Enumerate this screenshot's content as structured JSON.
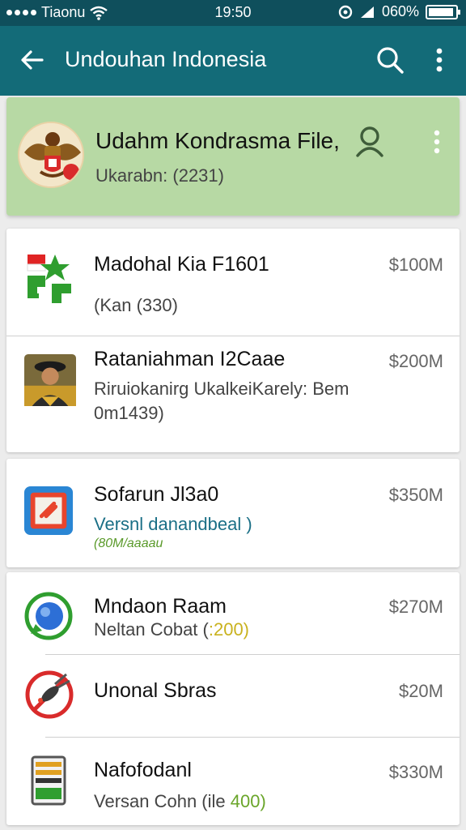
{
  "status_bar": {
    "carrier": "Tiaonu",
    "time": "19:50",
    "battery": "060%"
  },
  "toolbar": {
    "title": "Undouhan Indonesia",
    "icons": [
      "back-arrow-icon",
      "search-icon",
      "more-vert-icon"
    ]
  },
  "header": {
    "title": "Udahm Kondrasma File,",
    "subtitle": "Ukarabn: (2231)",
    "accent_color": "#b7d9a4"
  },
  "items": [
    {
      "title": "Madohal Kia F1601",
      "subtitle": "(Kan (330)",
      "price": "$100M"
    },
    {
      "title": "Rataniahman I2Caae",
      "subtitle": "Riruiokanirg UkalkeiKarely: Bem",
      "subtitle2": "0m1439)",
      "price": "$200M"
    },
    {
      "title": "Sofarun Jl3a0",
      "subtitle": "Versnl danandbeal )",
      "subtitle2": "(80M/aaaau",
      "price": "$350M"
    },
    {
      "title": "Mndaon Raam",
      "subtitle_prefix": "Neltan Cobat (",
      "subtitle_highlight": ":200)",
      "price": "$270M"
    },
    {
      "title": "Unonal Sbras",
      "price": "$20M"
    },
    {
      "title": "Nafofodanl",
      "subtitle_prefix": "Versan Cohn (ile ",
      "subtitle_highlight": "400)",
      "price": "$330M"
    }
  ],
  "colors": {
    "status_bar": "#0f4f5c",
    "toolbar": "#136b78",
    "highlight_teal": "#1a6f86",
    "highlight_green": "#5a9a2a",
    "highlight_yellow": "#c9b21e"
  }
}
